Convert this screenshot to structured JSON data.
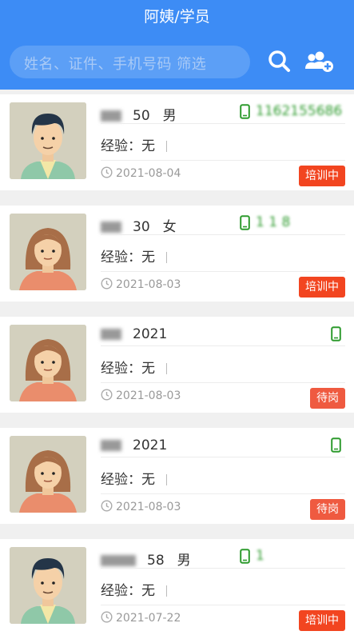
{
  "header": {
    "title": "阿姨/学员"
  },
  "search": {
    "placeholder": "姓名、证件、手机号码 筛选"
  },
  "icons": {
    "search": "search-icon",
    "add_user": "add-user-icon",
    "phone": "phone-icon",
    "clock": "clock-icon"
  },
  "colors": {
    "primary": "#3d8cf5",
    "badge_training": "#f24520",
    "badge_waiting": "#ef5a40",
    "phone_green": "#2e9b2e"
  },
  "cards": [
    {
      "avatar": "male",
      "name_tail": "50",
      "gender": "男",
      "phone": "1162155686",
      "experience": "经验：无",
      "date": "2021-08-04",
      "status": "培训中"
    },
    {
      "avatar": "female",
      "name_tail": "30",
      "gender": "女",
      "phone": "1 1 8",
      "experience": "经验：无",
      "date": "2021-08-03",
      "status": "培训中"
    },
    {
      "avatar": "female",
      "name_tail": "2021",
      "gender": "",
      "phone": "",
      "experience": "经验：无",
      "date": "2021-08-03",
      "status": "待岗"
    },
    {
      "avatar": "female",
      "name_tail": "2021",
      "gender": "",
      "phone": "",
      "experience": "经验：无",
      "date": "2021-08-03",
      "status": "待岗"
    },
    {
      "avatar": "male",
      "name_tail": "58",
      "gender": "男",
      "phone": "1",
      "experience": "经验：无",
      "date": "2021-07-22",
      "status": "培训中"
    }
  ]
}
